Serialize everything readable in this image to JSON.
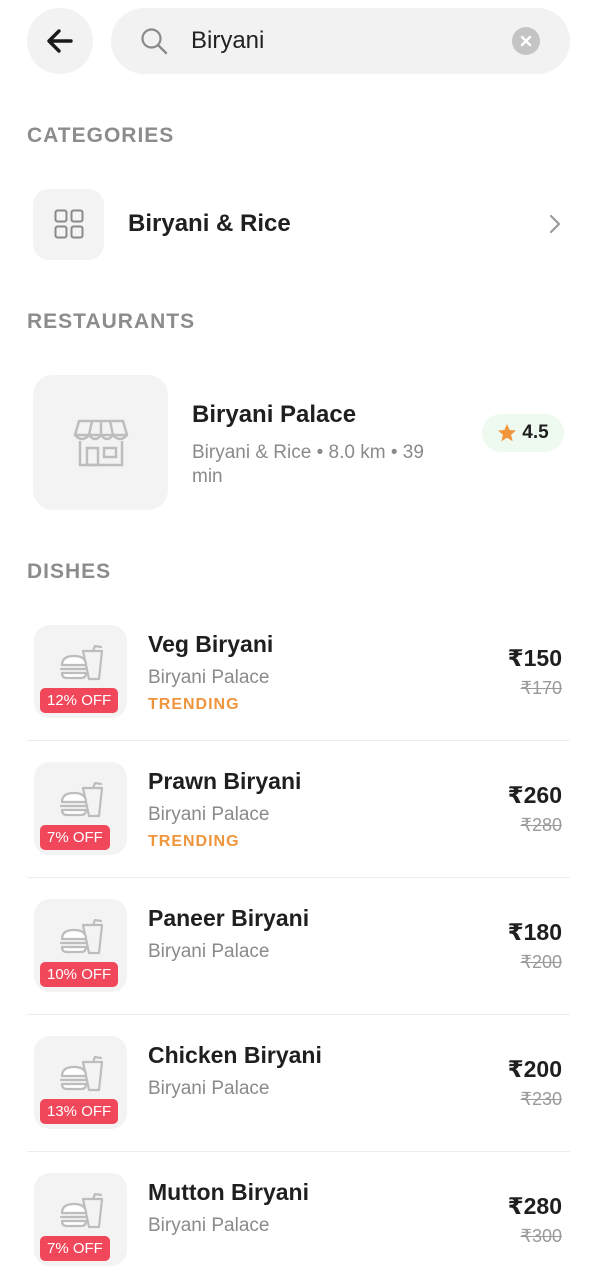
{
  "search": {
    "value": "Biryani"
  },
  "icons": {
    "back": "arrow-left-icon",
    "search": "search-icon",
    "clear": "clear-icon",
    "category": "grid-icon",
    "chevron": "chevron-right-icon",
    "store": "store-icon",
    "food": "food-icon",
    "star": "star-icon"
  },
  "colors": {
    "accent_orange": "#f0953c",
    "discount_red": "#f0475b",
    "rating_bg": "#eef9ef",
    "star": "#f0953c"
  },
  "sections": {
    "categories": "CATEGORIES",
    "restaurants": "RESTAURANTS",
    "dishes": "DISHES"
  },
  "category": {
    "label": "Biryani & Rice"
  },
  "restaurant": {
    "name": "Biryani Palace",
    "meta": "Biryani & Rice • 8.0 km • 39 min",
    "rating": "4.5"
  },
  "dishes": [
    {
      "name": "Veg Biryani",
      "restaurant": "Biryani Palace",
      "tag": "TRENDING",
      "discount": "12% OFF",
      "price": "₹150",
      "old_price": "₹170"
    },
    {
      "name": "Prawn Biryani",
      "restaurant": "Biryani Palace",
      "tag": "TRENDING",
      "discount": "7% OFF",
      "price": "₹260",
      "old_price": "₹280"
    },
    {
      "name": "Paneer Biryani",
      "restaurant": "Biryani Palace",
      "tag": "",
      "discount": "10% OFF",
      "price": "₹180",
      "old_price": "₹200"
    },
    {
      "name": "Chicken Biryani",
      "restaurant": "Biryani Palace",
      "tag": "",
      "discount": "13% OFF",
      "price": "₹200",
      "old_price": "₹230"
    },
    {
      "name": "Mutton Biryani",
      "restaurant": "Biryani Palace",
      "tag": "",
      "discount": "7% OFF",
      "price": "₹280",
      "old_price": "₹300"
    }
  ]
}
